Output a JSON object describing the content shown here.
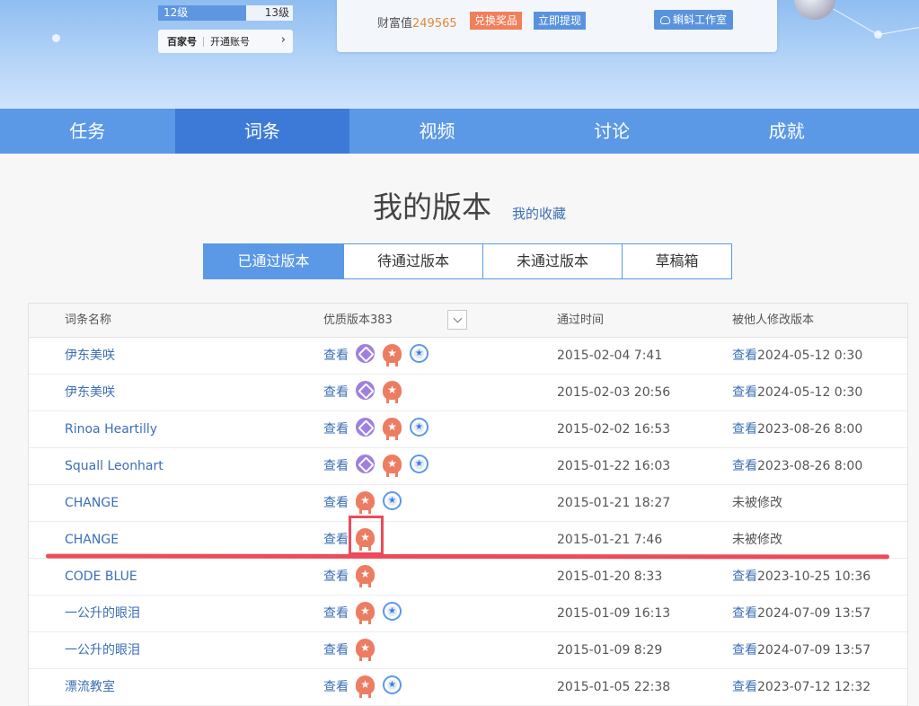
{
  "header": {
    "level_current": "12级",
    "level_next": "13级",
    "level_progress": 0.65,
    "bjh_logo": "百家号",
    "bjh_action": "开通账号",
    "wealth_label": "财富值",
    "wealth_value": "249565",
    "redeem_label": "兑换奖品",
    "withdraw_label": "立即提现",
    "studio_label": "蝌蚪工作室"
  },
  "nav": {
    "items": [
      "任务",
      "词条",
      "视频",
      "讨论",
      "成就"
    ],
    "active": "词条"
  },
  "page": {
    "title": "我的版本",
    "favorites_link": "我的收藏"
  },
  "tabs": [
    "已通过版本",
    "待通过版本",
    "未通过版本",
    "草稿箱"
  ],
  "table": {
    "headers": {
      "name": "词条名称",
      "quality": "优质版本383",
      "time": "通过时间",
      "modified": "被他人修改版本"
    },
    "view_label": "查看",
    "rows": [
      {
        "name": "伊东美咲",
        "badges": [
          "purple",
          "orange",
          "blue"
        ],
        "date": "2015-02-04 7:41",
        "mod_link": "查看",
        "mod_date": "2024-05-12 0:30"
      },
      {
        "name": "伊东美咲",
        "badges": [
          "purple",
          "orange"
        ],
        "date": "2015-02-03 20:56",
        "mod_link": "查看",
        "mod_date": "2024-05-12 0:30"
      },
      {
        "name": "Rinoa Heartilly",
        "badges": [
          "purple",
          "orange",
          "blue"
        ],
        "date": "2015-02-02 16:53",
        "mod_link": "查看",
        "mod_date": "2023-08-26 8:00"
      },
      {
        "name": "Squall Leonhart",
        "badges": [
          "purple",
          "orange",
          "blue"
        ],
        "date": "2015-01-22 16:03",
        "mod_link": "查看",
        "mod_date": "2023-08-26 8:00"
      },
      {
        "name": "CHANGE",
        "badges": [
          "orange",
          "blue"
        ],
        "date": "2015-01-21 18:27",
        "mod_text": "未被修改"
      },
      {
        "name": "CHANGE",
        "badges": [
          "orange"
        ],
        "date": "2015-01-21 7:46",
        "mod_text": "未被修改"
      },
      {
        "name": "CODE BLUE",
        "badges": [
          "orange"
        ],
        "date": "2015-01-20 8:33",
        "mod_link": "查看",
        "mod_date": "2023-10-25 10:36"
      },
      {
        "name": "一公升的眼泪",
        "badges": [
          "orange",
          "blue"
        ],
        "date": "2015-01-09 16:13",
        "mod_link": "查看",
        "mod_date": "2024-07-09 13:57"
      },
      {
        "name": "一公升的眼泪",
        "badges": [
          "orange"
        ],
        "date": "2015-01-09 8:29",
        "mod_link": "查看",
        "mod_date": "2024-07-09 13:57"
      },
      {
        "name": "漂流教室",
        "badges": [
          "orange",
          "blue"
        ],
        "date": "2015-01-05 22:38",
        "mod_link": "查看",
        "mod_date": "2023-07-12 12:32"
      }
    ]
  },
  "colors": {
    "primary": "#5b98e6",
    "nav_active": "#3d7ad8",
    "link": "#3b6fb6",
    "badge_purple": "#9e80e0",
    "badge_orange": "#ec7d62",
    "annotation": "#ee4a5a"
  }
}
